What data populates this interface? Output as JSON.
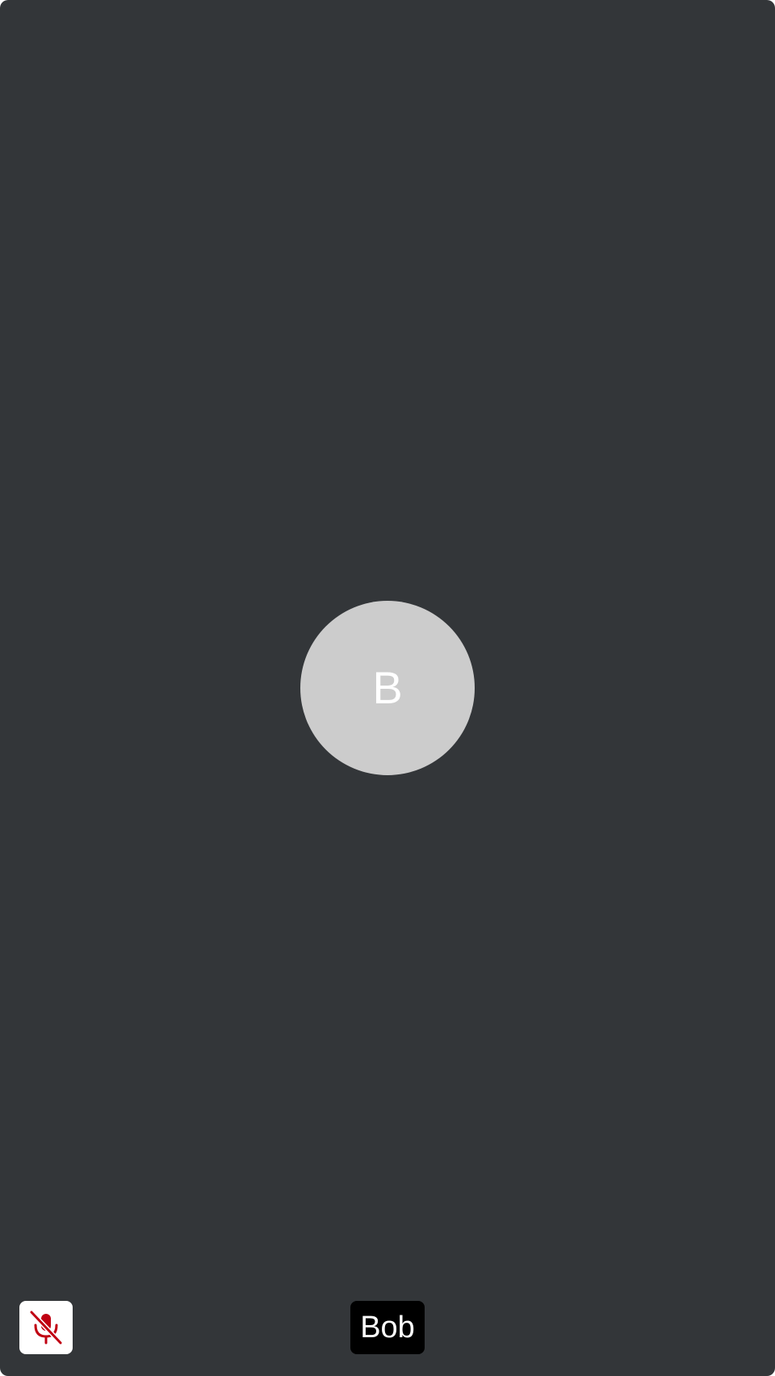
{
  "participant": {
    "name": "Bob",
    "initial": "B"
  },
  "indicators": {
    "microphone": "mic-off-icon",
    "muted": true
  },
  "colors": {
    "tile_background": "#333639",
    "avatar_background": "#cccccc",
    "mute_icon": "#c00012",
    "name_badge_background": "#000000"
  }
}
